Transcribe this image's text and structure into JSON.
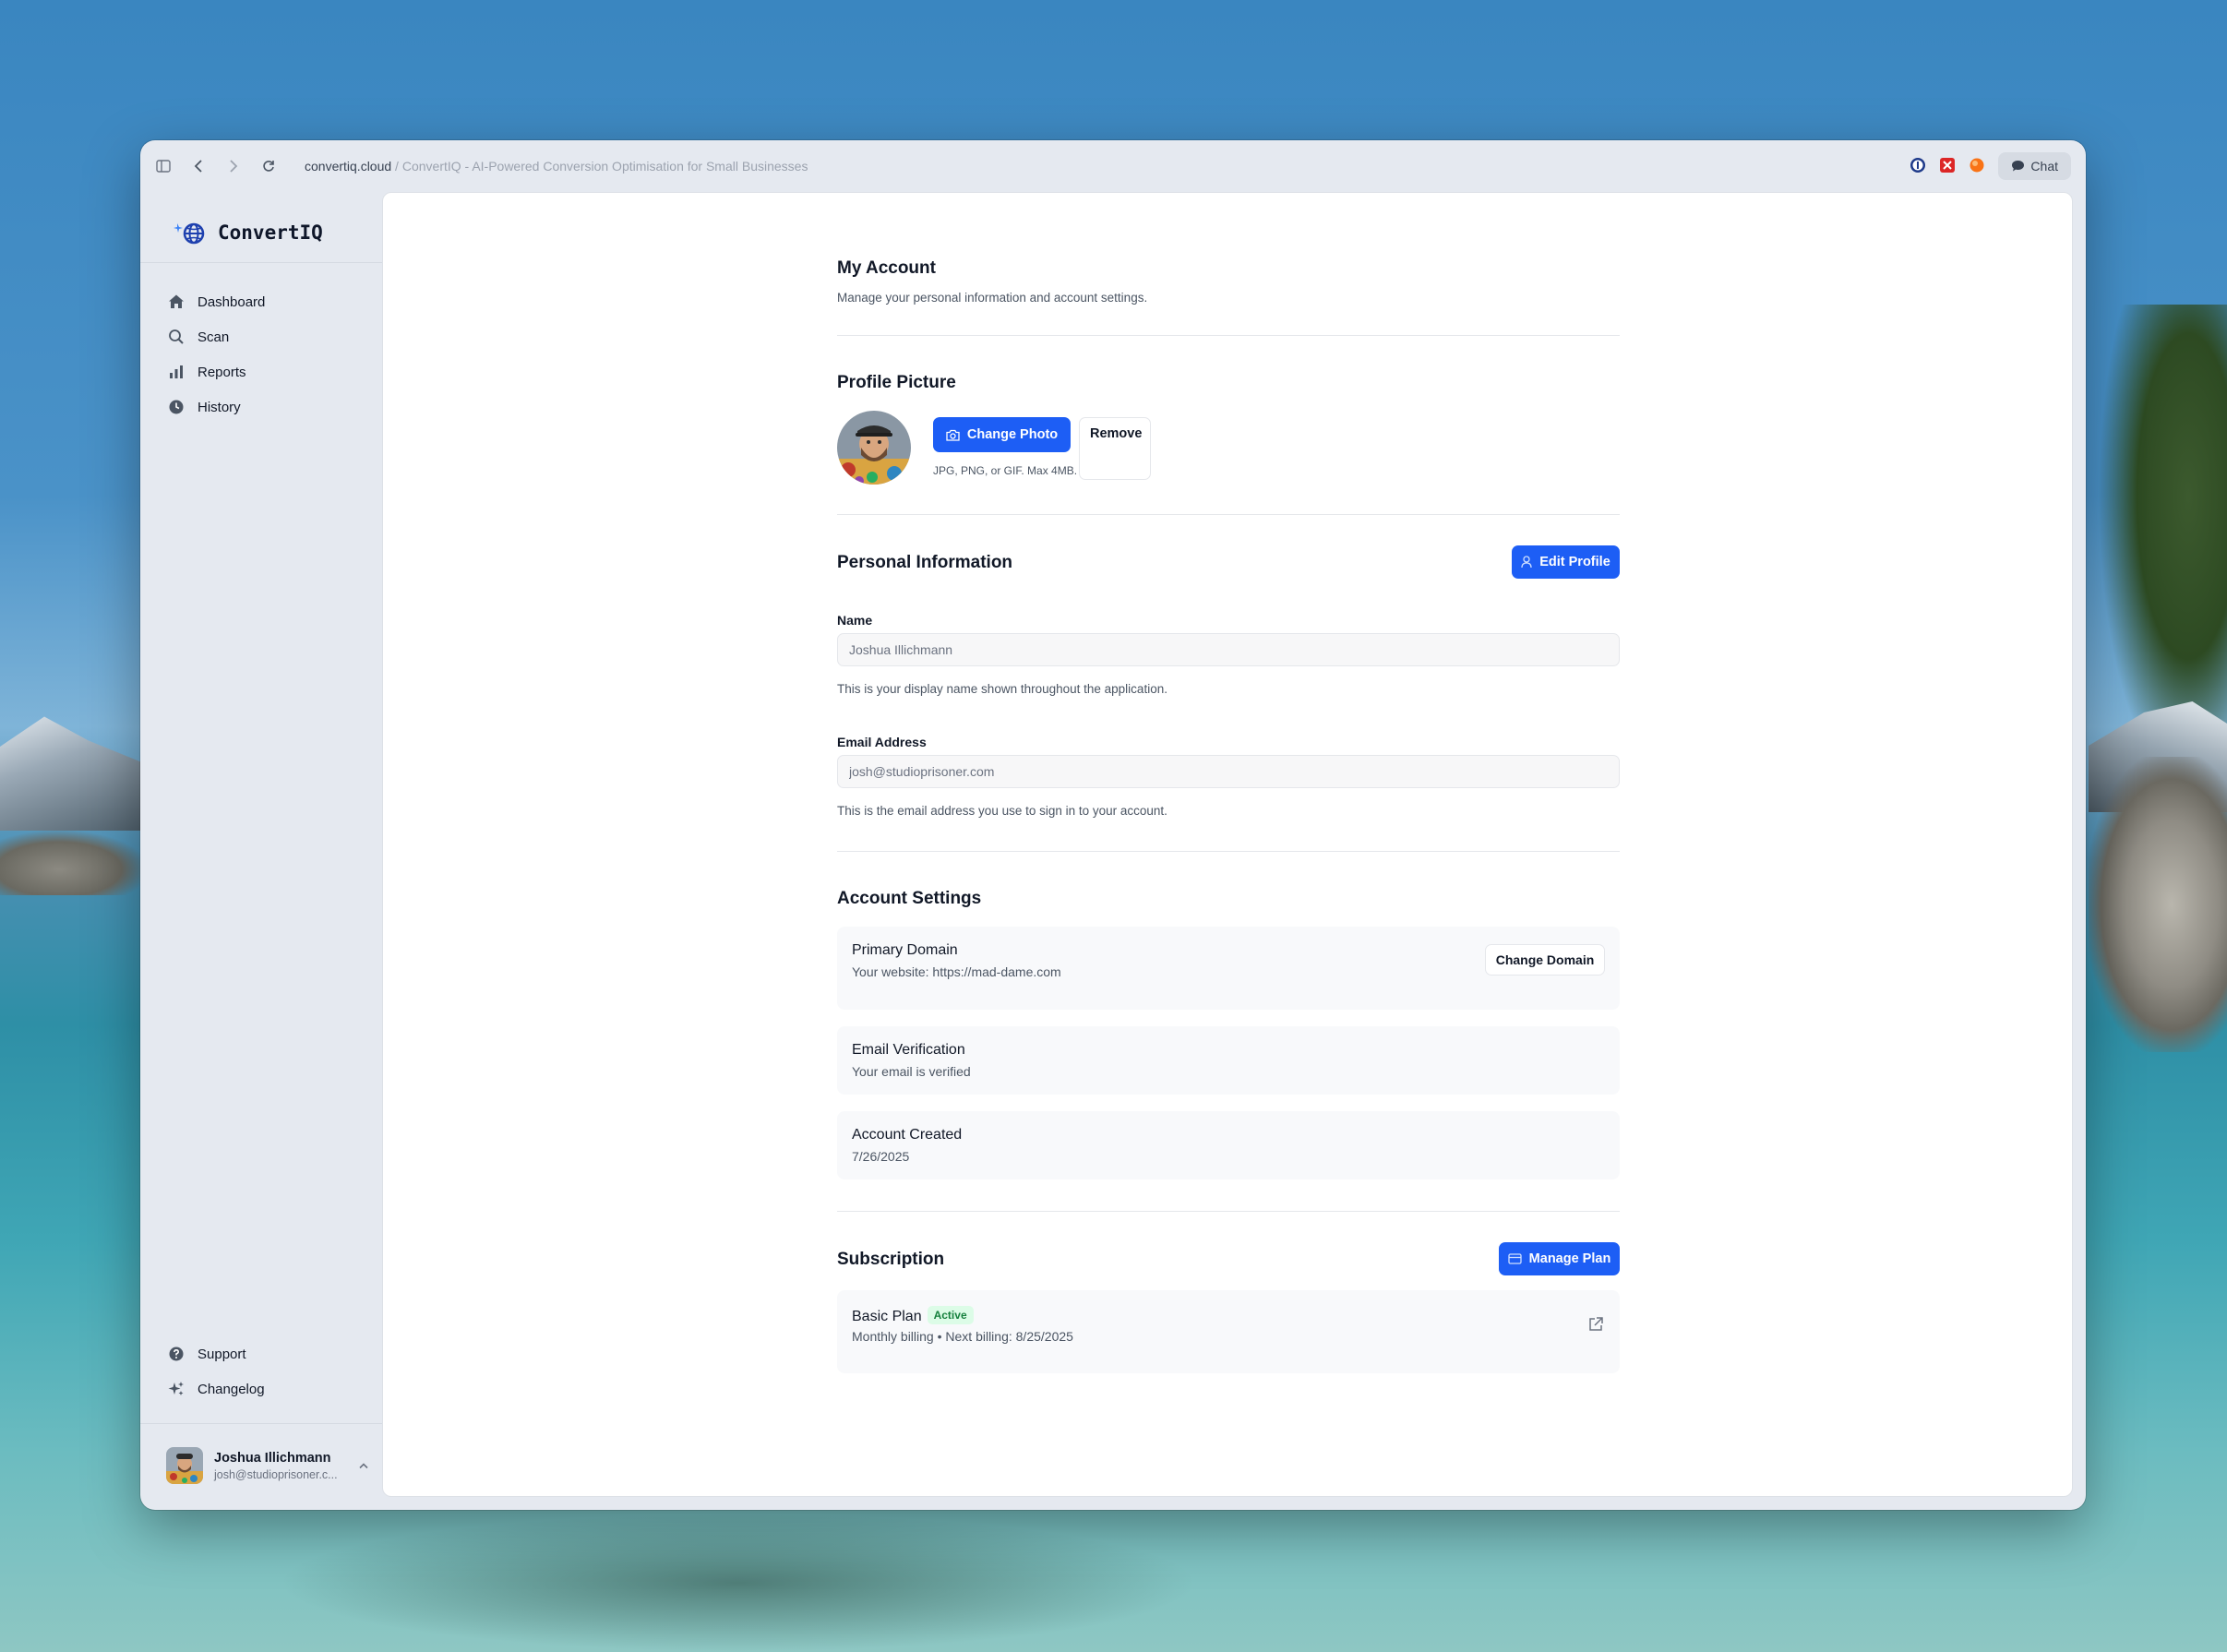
{
  "browser": {
    "domain": "convertiq.cloud",
    "separator": " / ",
    "page_title": "ConvertIQ - AI-Powered Conversion Optimisation for Small Businesses",
    "chat_label": "Chat"
  },
  "sidebar": {
    "brand": "ConvertIQ",
    "nav": [
      {
        "label": "Dashboard",
        "icon": "home-icon"
      },
      {
        "label": "Scan",
        "icon": "search-icon"
      },
      {
        "label": "Reports",
        "icon": "bar-chart-icon"
      },
      {
        "label": "History",
        "icon": "clock-icon"
      }
    ],
    "bottom_nav": [
      {
        "label": "Support",
        "icon": "help-circle-icon"
      },
      {
        "label": "Changelog",
        "icon": "sparkles-icon"
      }
    ],
    "user": {
      "name": "Joshua Illichmann",
      "email": "josh@studioprisoner.c..."
    }
  },
  "account": {
    "title": "My Account",
    "subtitle": "Manage your personal information and account settings."
  },
  "profile_picture": {
    "title": "Profile Picture",
    "change_label": "Change Photo",
    "remove_label": "Remove",
    "hint": "JPG, PNG, or GIF. Max 4MB."
  },
  "personal_info": {
    "title": "Personal Information",
    "edit_label": "Edit Profile",
    "name_label": "Name",
    "name_value": "Joshua Illichmann",
    "name_help": "This is your display name shown throughout the application.",
    "email_label": "Email Address",
    "email_value": "josh@studioprisoner.com",
    "email_help": "This is the email address you use to sign in to your account."
  },
  "account_settings": {
    "title": "Account Settings",
    "domain_title": "Primary Domain",
    "domain_sub": "Your website: https://mad-dame.com",
    "domain_button": "Change Domain",
    "verify_title": "Email Verification",
    "verify_sub": "Your email is verified",
    "created_title": "Account Created",
    "created_sub": "7/26/2025"
  },
  "subscription": {
    "title": "Subscription",
    "manage_label": "Manage Plan",
    "plan_name": "Basic Plan",
    "plan_status": "Active",
    "plan_billing": "Monthly billing • Next billing: 8/25/2025"
  },
  "colors": {
    "primary": "#1d5ef5",
    "sidebar_bg": "#e5e9f0",
    "badge_bg": "#dcfce7",
    "badge_text": "#15803d"
  }
}
